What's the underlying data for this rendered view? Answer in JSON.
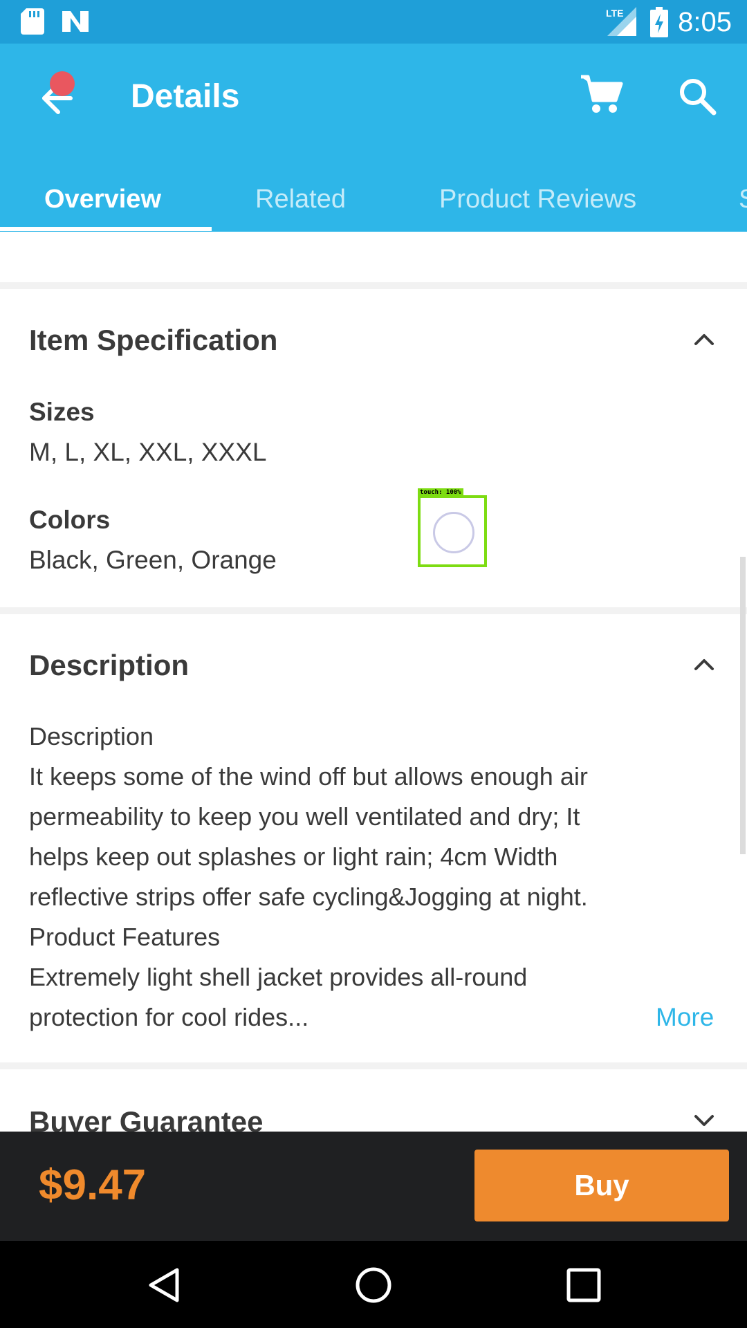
{
  "status_bar": {
    "time": "8:05",
    "network": "LTE",
    "left_icons": [
      "sd-card-icon",
      "n-logo-icon"
    ],
    "right_icons": [
      "lte-signal-icon",
      "battery-charging-icon"
    ]
  },
  "app_bar": {
    "title": "Details",
    "icons": [
      "back-arrow-icon",
      "cart-icon",
      "search-icon"
    ],
    "tabs": [
      {
        "label": "Overview",
        "active": true
      },
      {
        "label": "Related",
        "active": false
      },
      {
        "label": "Product Reviews",
        "active": false
      },
      {
        "label": "S",
        "active": false
      }
    ]
  },
  "item_spec": {
    "title": "Item Specification",
    "sizes_label": "Sizes",
    "sizes_value": "M, L, XL, XXL, XXXL",
    "colors_label": "Colors",
    "colors_value": "Black, Green, Orange"
  },
  "description": {
    "title": "Description",
    "lines": [
      "Description",
      "It keeps some of the wind off but allows enough air",
      "permeability to keep you well ventilated and dry; It",
      "helps keep out splashes or light rain; 4cm Width",
      "reflective strips offer safe cycling&Jogging at night.",
      "Product Features",
      "Extremely light shell jacket provides all-round",
      "protection for cool rides..."
    ],
    "more_label": "More"
  },
  "buyer_guarantee": {
    "title": "Buyer Guarantee"
  },
  "touch_overlay": {
    "label": "touch: 100%"
  },
  "bottom_bar": {
    "price": "$9.47",
    "buy_label": "Buy"
  },
  "colors": {
    "primary": "#2eb6e8",
    "status_bar": "#1f9fd8",
    "accent_orange": "#ee8a2e",
    "dark_bar": "#1f2022",
    "text": "#3a3a3a"
  }
}
